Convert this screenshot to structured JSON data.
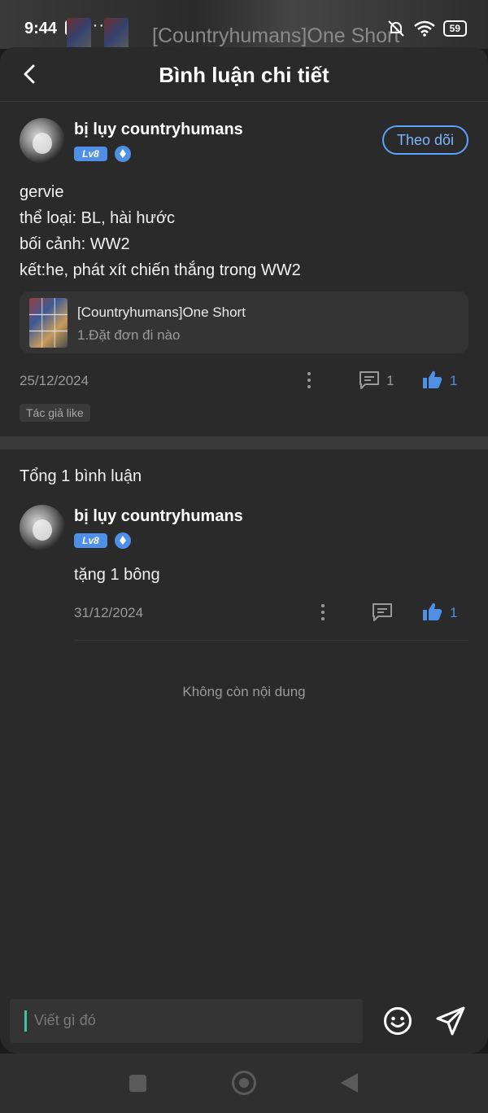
{
  "status_bar": {
    "time": "9:44",
    "upload_glyph": "↑",
    "overflow": "···",
    "behind_title": "[Countryhumans]One Short",
    "battery": "59"
  },
  "header": {
    "title": "Bình luận chi tiết"
  },
  "post": {
    "username": "bị lụy countryhumans",
    "level": "Lv8",
    "follow_label": "Theo dõi",
    "lines": [
      "gervie",
      "thể loại: BL, hài hước",
      "bối cảnh: WW2",
      "kết:he, phát xít chiến thắng trong WW2"
    ],
    "book": {
      "title": "[Countryhumans]One Short",
      "chapter": "1.Đặt đơn đi nào"
    },
    "date": "25/12/2024",
    "comment_count": "1",
    "like_count": "1",
    "author_like": "Tác giả like"
  },
  "comments": {
    "total_label": "Tổng 1 bình luận",
    "items": [
      {
        "username": "bị lụy countryhumans",
        "level": "Lv8",
        "text": "tặng 1 bông",
        "date": "31/12/2024",
        "like_count": "1"
      }
    ],
    "end_label": "Không còn nội dung"
  },
  "input": {
    "placeholder": "Viết gì đó"
  },
  "colors": {
    "accent": "#4f8fe6",
    "follow": "#5aa2ff",
    "caret": "#3cc6a0"
  }
}
